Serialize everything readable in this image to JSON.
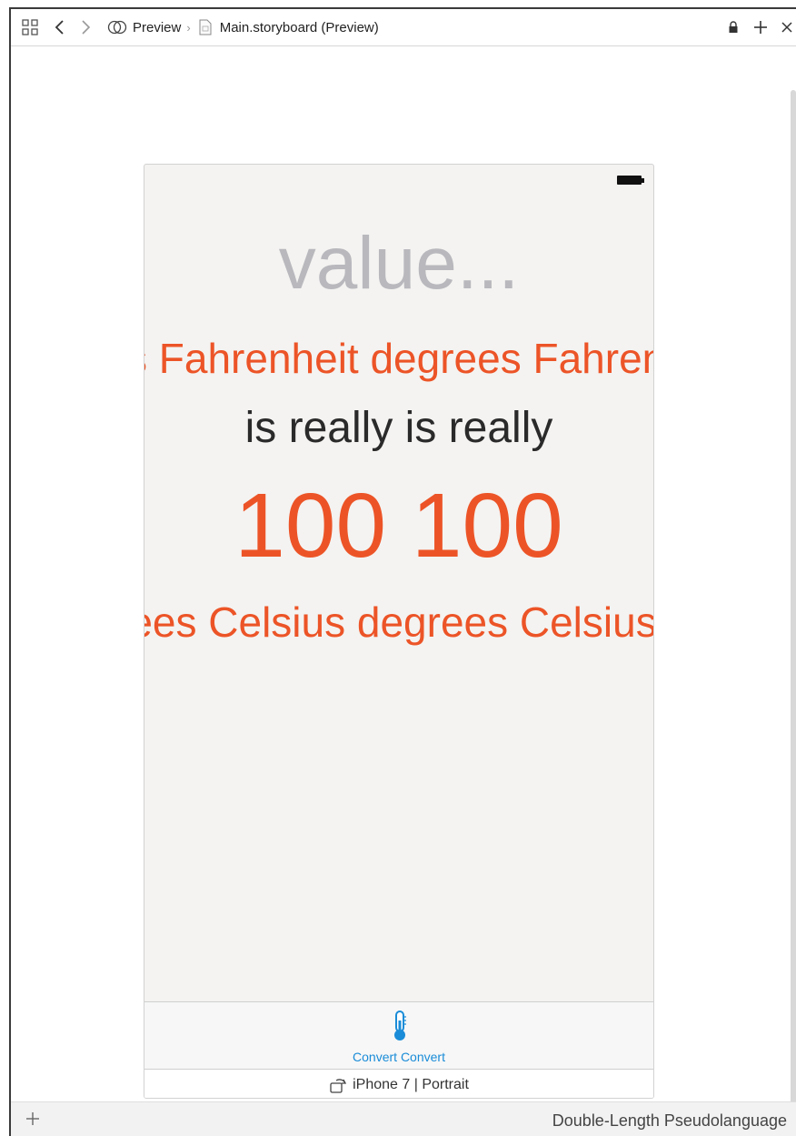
{
  "jumpbar": {
    "crumb_preview": "Preview",
    "crumb_file": "Main.storyboard (Preview)"
  },
  "preview": {
    "value_placeholder": "value...",
    "fahrenheit_label": "s Fahrenheit degrees Fahrenheit",
    "is_really_label": "is really is really",
    "result_value": "100 100",
    "celsius_label": "rees Celsius degrees Celsius",
    "tab_label": "Convert Convert",
    "device_label": "iPhone 7 | Portrait"
  },
  "bottombar": {
    "language": "Double-Length Pseudolanguage"
  },
  "colors": {
    "accent_orange": "#ec5427",
    "tab_blue": "#1a8cd8",
    "placeholder_gray": "#b8b8bd"
  },
  "icons": {
    "grid": "grid-icon",
    "back": "chevron-left-icon",
    "forward": "chevron-right-icon",
    "preview": "preview-icon",
    "file": "storyboard-file-icon",
    "lock": "lock-icon",
    "add": "plus-icon",
    "close": "close-icon",
    "battery": "battery-icon",
    "thermometer": "thermometer-icon",
    "rotate": "rotate-icon"
  }
}
